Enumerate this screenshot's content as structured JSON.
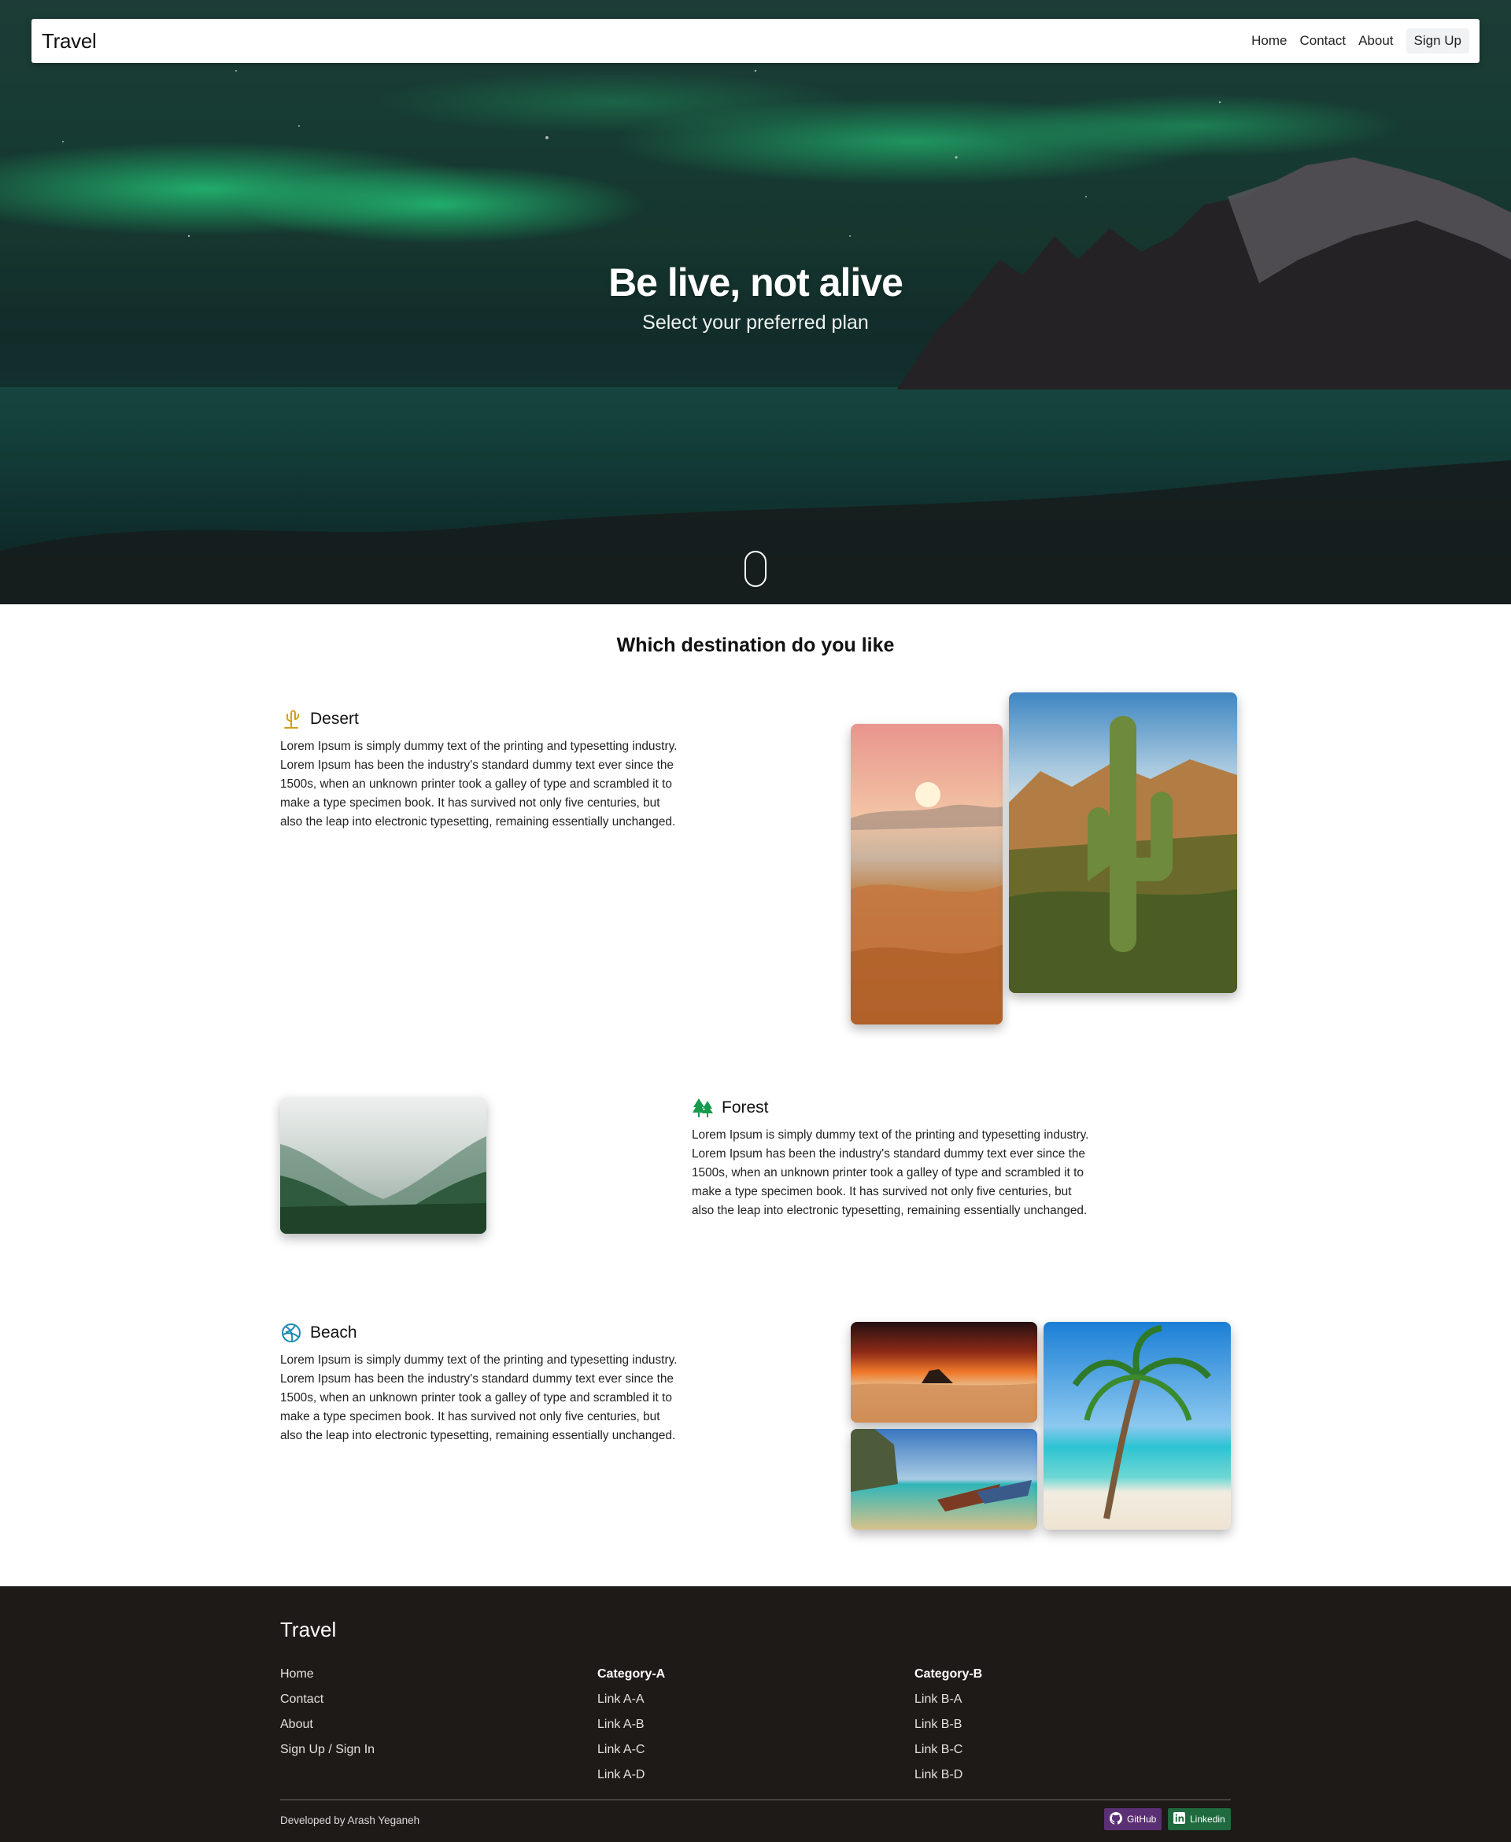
{
  "nav": {
    "brand": "Travel",
    "links": [
      "Home",
      "Contact",
      "About"
    ],
    "signup": "Sign Up"
  },
  "hero": {
    "title": "Be live, not alive",
    "subtitle": "Select your preferred plan"
  },
  "destinations": {
    "title": "Which destination do you like",
    "items": [
      {
        "name": "Desert",
        "icon": "cactus-icon",
        "icon_color": "#d4a017",
        "text": "Lorem Ipsum is simply dummy text of the printing and typesetting industry. Lorem Ipsum has been the industry's standard dummy text ever since the 1500s, when an unknown printer took a galley of type and scrambled it to make a type specimen book. It has survived not only five centuries, but also the leap into electronic typesetting, remaining essentially unchanged."
      },
      {
        "name": "Forest",
        "icon": "trees-icon",
        "icon_color": "#169a4e",
        "text": "Lorem Ipsum is simply dummy text of the printing and typesetting industry. Lorem Ipsum has been the industry's standard dummy text ever since the 1500s, when an unknown printer took a galley of type and scrambled it to make a type specimen book. It has survived not only five centuries, but also the leap into electronic typesetting, remaining essentially unchanged."
      },
      {
        "name": "Beach",
        "icon": "beach-ball-icon",
        "icon_color": "#1a8ab5",
        "text": "Lorem Ipsum is simply dummy text of the printing and typesetting industry. Lorem Ipsum has been the industry's standard dummy text ever since the 1500s, when an unknown printer took a galley of type and scrambled it to make a type specimen book. It has survived not only five centuries, but also the leap into electronic typesetting, remaining essentially unchanged."
      }
    ]
  },
  "footer": {
    "brand": "Travel",
    "col1": [
      "Home",
      "Contact",
      "About",
      "Sign Up / Sign In"
    ],
    "col2": {
      "heading": "Category-A",
      "links": [
        "Link A-A",
        "Link A-B",
        "Link A-C",
        "Link A-D"
      ]
    },
    "col3": {
      "heading": "Category-B",
      "links": [
        "Link B-A",
        "Link B-B",
        "Link B-C",
        "Link B-D"
      ]
    },
    "credit": "Developed by Arash Yeganeh",
    "github": "GitHub",
    "linkedin": "Linkedin"
  },
  "colors": {
    "footer_bg": "#1e1a17",
    "github_badge": "#5a2f73",
    "linkedin_badge": "#1f6a3e"
  }
}
